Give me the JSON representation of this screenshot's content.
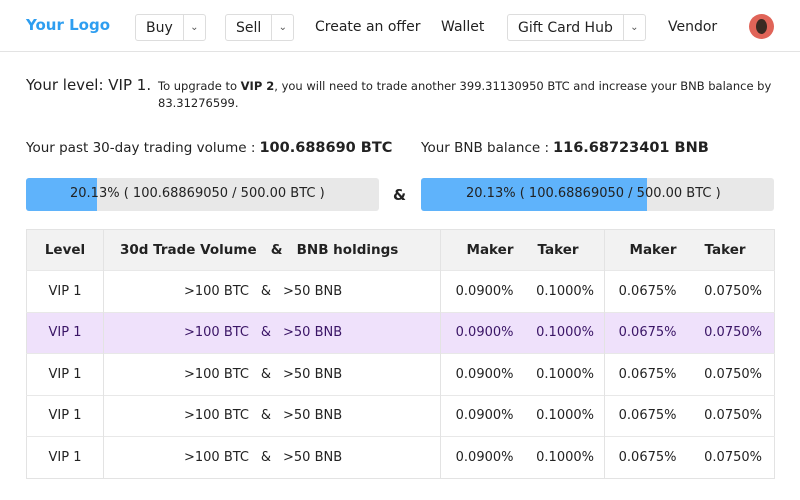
{
  "nav": {
    "logo": "Your Logo",
    "buy": "Buy",
    "sell": "Sell",
    "create_offer": "Create an offer",
    "wallet": "Wallet",
    "gift_card_hub": "Gift Card Hub",
    "vendor": "Vendor"
  },
  "level": {
    "label": "Your level: VIP 1.",
    "desc_pre": "To upgrade to ",
    "next": "VIP 2",
    "desc_post": ", you will need to trade another 399.31130950 BTC and increase your BNB balance by 83.31276599."
  },
  "stats": {
    "volume_label": "Your past 30-day trading volume :",
    "volume_value": "100.688690 BTC",
    "bnb_label": "Your BNB balance :",
    "bnb_value": "116.68723401 BNB"
  },
  "progress": [
    {
      "percent": "20.13%",
      "detail": "( 100.68869050 / 500.00 BTC )",
      "fill_fraction": 0.2013
    },
    {
      "percent": "20.13%",
      "detail": "( 100.68869050 / 500.00 BTC )",
      "fill_fraction": 0.64
    }
  ],
  "amp": "&",
  "table": {
    "headers": {
      "level": "Level",
      "volume": "30d Trade Volume",
      "amp": "&",
      "bnb": "BNB holdings",
      "maker1": "Maker",
      "taker1": "Taker",
      "maker2": "Maker",
      "taker2": "Taker"
    },
    "rows": [
      {
        "level": "VIP 1",
        "volume": ">100 BTC",
        "amp": "&",
        "bnb": ">50 BNB",
        "maker1": "0.0900%",
        "taker1": "0.1000%",
        "maker2": "0.0675%",
        "taker2": "0.0750%"
      },
      {
        "level": "VIP 1",
        "volume": ">100 BTC",
        "amp": "&",
        "bnb": ">50 BNB",
        "maker1": "0.0900%",
        "taker1": "0.1000%",
        "maker2": "0.0675%",
        "taker2": "0.0750%",
        "highlighted": true
      },
      {
        "level": "VIP 1",
        "volume": ">100 BTC",
        "amp": "&",
        "bnb": ">50 BNB",
        "maker1": "0.0900%",
        "taker1": "0.1000%",
        "maker2": "0.0675%",
        "taker2": "0.0750%"
      },
      {
        "level": "VIP 1",
        "volume": ">100 BTC",
        "amp": "&",
        "bnb": ">50 BNB",
        "maker1": "0.0900%",
        "taker1": "0.1000%",
        "maker2": "0.0675%",
        "taker2": "0.0750%"
      },
      {
        "level": "VIP 1",
        "volume": ">100 BTC",
        "amp": "&",
        "bnb": ">50 BNB",
        "maker1": "0.0900%",
        "taker1": "0.1000%",
        "maker2": "0.0675%",
        "taker2": "0.0750%"
      }
    ]
  }
}
